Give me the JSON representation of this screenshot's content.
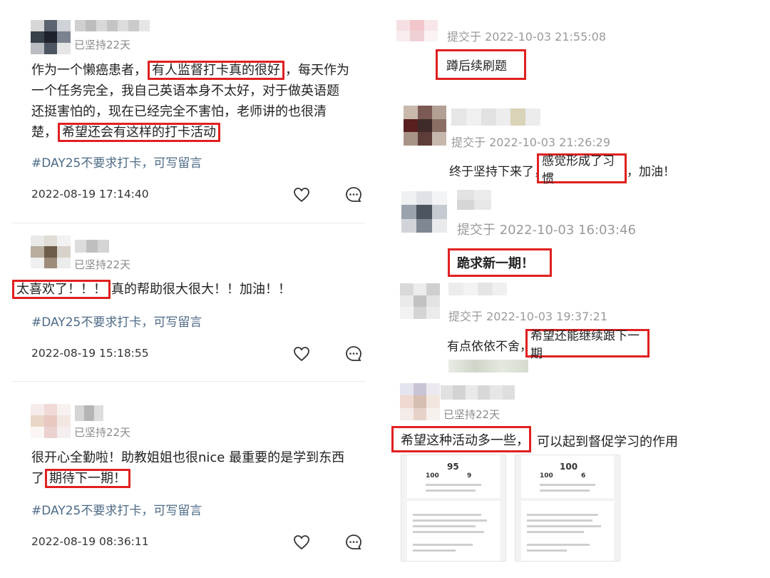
{
  "left_posts": [
    {
      "status": "已坚持22天",
      "text_lines": [
        "作为一个懒癌患者，",
        "有人监督打卡真的很好",
        "，每天作为",
        "一个任务完全，我自己英语本身不太好，对于做英语题",
        "还挺害怕的，现在已经完全不害怕，老师讲的也很清",
        "楚，",
        "希望还会有这样的打卡活动"
      ],
      "tag": "#DAY25不要求打卡，可写留言",
      "date": "2022-08-19 17:14:40"
    },
    {
      "status": "已坚持22天",
      "text_lines": [
        "太喜欢了！！！",
        "真的帮助很大很大！！加油！！"
      ],
      "tag": "#DAY25不要求打卡，可写留言",
      "date": "2022-08-19 15:18:55"
    },
    {
      "status": "已坚持22天",
      "text_lines": [
        "很开心全勤啦！助教姐姐也很nice 最重要的是学到东西",
        "了",
        "期待下一期！"
      ],
      "tag": "#DAY25不要求打卡，可写留言",
      "date": "2022-08-19 08:36:11"
    }
  ],
  "right_posts": [
    {
      "stamp": "提交于 2022-10-03 21:55:08",
      "box": "蹲后续刷题"
    },
    {
      "stamp": "提交于 2022-10-03 21:26:29",
      "pre": "终于坚持下来了，",
      "box": "感觉形成了习惯",
      "post": "，加油！"
    },
    {
      "stamp": "提交于 2022-10-03 16:03:46",
      "box": "跪求新一期！"
    },
    {
      "stamp": "提交于 2022-10-03 19:37:21",
      "pre": "有点依依不舍，",
      "box": "希望还能继续跟下一期"
    },
    {
      "status": "已坚持22天",
      "box": "希望这种活动多一些，",
      "post": "可以起到督促学习的作用"
    }
  ],
  "screenshots": [
    {
      "score": "95",
      "stat_a": "100",
      "stat_b": "9"
    },
    {
      "score": "100",
      "stat_a": "100",
      "stat_b": "6"
    }
  ],
  "icons": {
    "like": "heart-icon",
    "comment": "comment-icon"
  },
  "colors": {
    "highlight": "#e02020",
    "tag": "#4d6a86"
  }
}
